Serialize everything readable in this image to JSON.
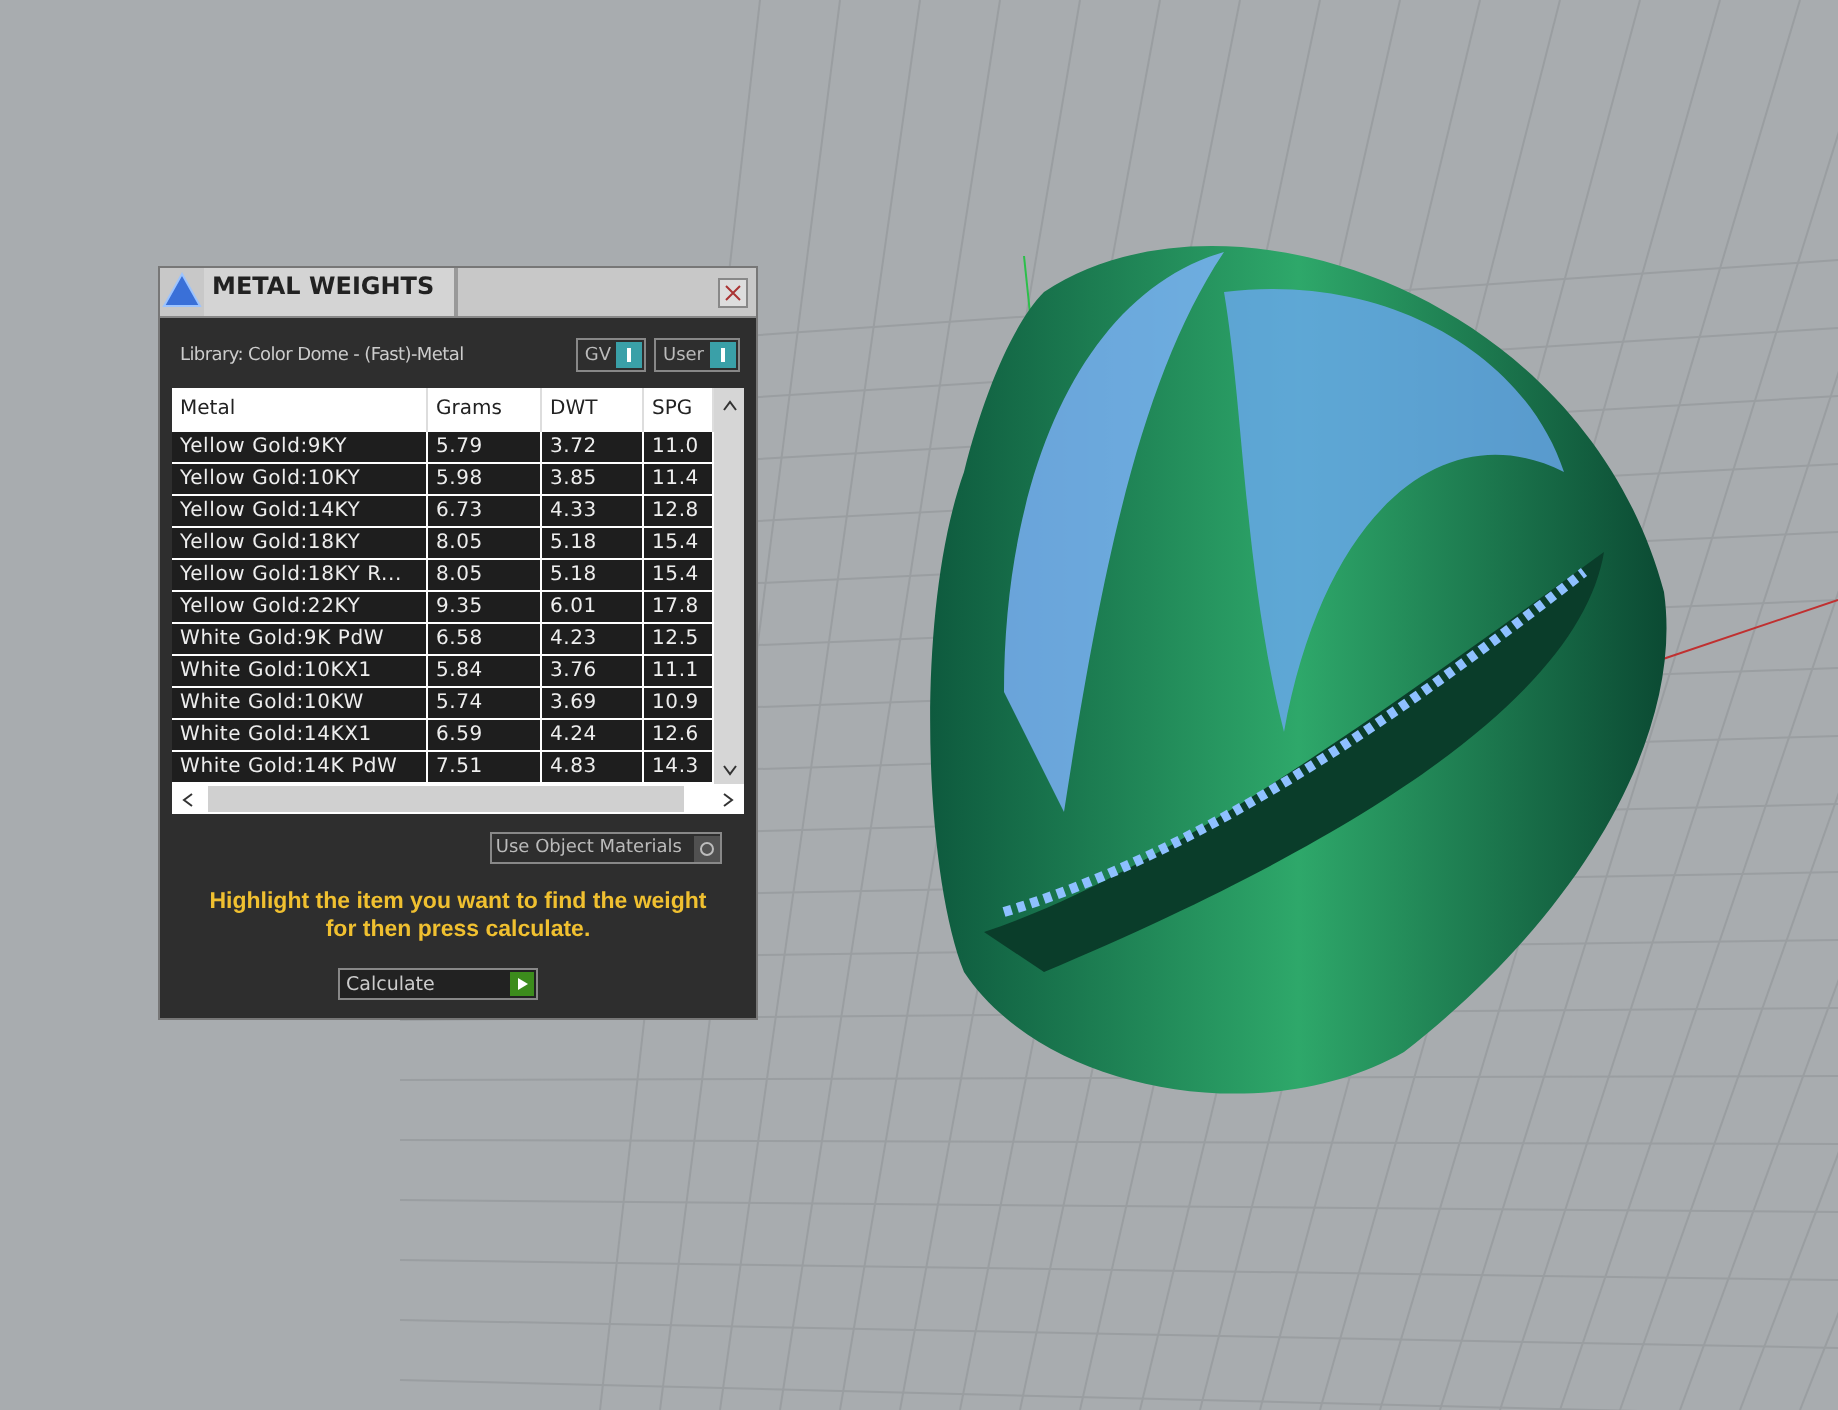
{
  "dialog": {
    "title": "METAL WEIGHTS",
    "library": "Library: Color Dome - (Fast)-Metal",
    "toggles": [
      {
        "label": "GV",
        "on": true
      },
      {
        "label": "User",
        "on": true
      }
    ],
    "table": {
      "columns": [
        "Metal",
        "Grams",
        "DWT",
        "SPG"
      ],
      "rows": [
        [
          "Yellow Gold:9KY",
          "5.79",
          "3.72",
          "11.0"
        ],
        [
          "Yellow Gold:10KY",
          "5.98",
          "3.85",
          "11.4"
        ],
        [
          "Yellow Gold:14KY",
          "6.73",
          "4.33",
          "12.8"
        ],
        [
          "Yellow Gold:18KY",
          "8.05",
          "5.18",
          "15.4"
        ],
        [
          "Yellow Gold:18KY R...",
          "8.05",
          "5.18",
          "15.4"
        ],
        [
          "Yellow Gold:22KY",
          "9.35",
          "6.01",
          "17.8"
        ],
        [
          "White Gold:9K PdW",
          "6.58",
          "4.23",
          "12.5"
        ],
        [
          "White Gold:10KX1",
          "5.84",
          "3.76",
          "11.1"
        ],
        [
          "White Gold:10KW",
          "5.74",
          "3.69",
          "10.9"
        ],
        [
          "White Gold:14KX1",
          "6.59",
          "4.24",
          "12.6"
        ],
        [
          "White Gold:14K PdW",
          "7.51",
          "4.83",
          "14.3"
        ]
      ]
    },
    "use_object_materials": {
      "label": "Use Object Materials",
      "on": false
    },
    "hint": "Highlight the item you want to find the weight for then press calculate.",
    "calculate_button": "Calculate"
  }
}
